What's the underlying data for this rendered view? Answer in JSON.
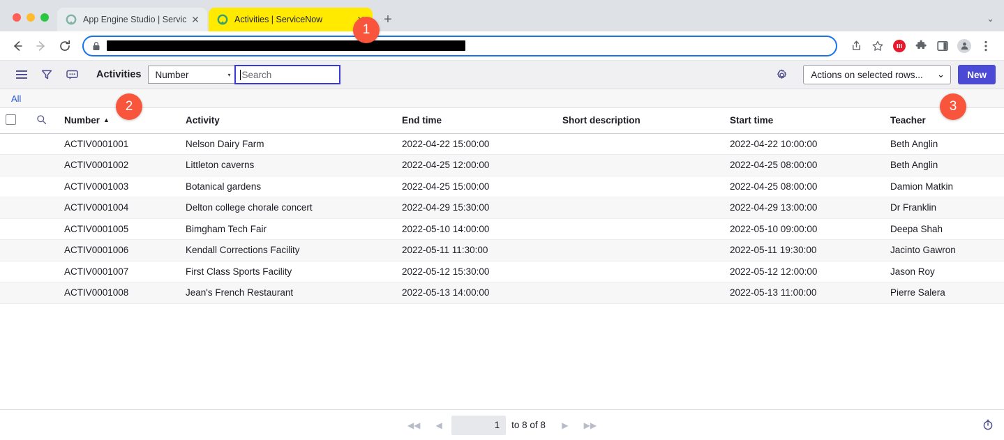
{
  "browser": {
    "tabs": [
      {
        "title": "App Engine Studio | ServiceNo",
        "favicon": "servicenow-logo-icon",
        "active": false
      },
      {
        "title": "Activities | ServiceNow",
        "favicon": "servicenow-logo-icon",
        "active": true
      }
    ],
    "new_tab_label": "+",
    "tab_list_chevron": "⌄",
    "close_label": "✕",
    "address_bar": {
      "value": "",
      "redacted": true,
      "lock": "site-secure-lock-icon"
    },
    "nav": {
      "back": "back-icon",
      "forward": "forward-icon",
      "reload": "reload-icon"
    },
    "toolbar_icons": [
      "share-icon",
      "bookmark-star-icon",
      "extension-red-icon",
      "extensions-puzzle-icon",
      "side-panel-icon",
      "profile-avatar-icon",
      "chrome-menu-icon"
    ]
  },
  "list_header": {
    "menu_icon": "hamburger-menu-icon",
    "filter_icon": "filter-funnel-icon",
    "comment_icon": "comment-bubble-icon",
    "title": "Activities",
    "field_select": {
      "value": "Number",
      "caret": "▾"
    },
    "search": {
      "value": "",
      "placeholder": "Search",
      "focused": true
    },
    "settings_icon": "gear-icon",
    "actions_select": {
      "value": "Actions on selected rows...",
      "caret": "⌄"
    },
    "new_button": "New"
  },
  "breadcrumb": {
    "label": "All"
  },
  "table": {
    "columns": [
      {
        "key": "check",
        "label": ""
      },
      {
        "key": "search",
        "label": ""
      },
      {
        "key": "number",
        "label": "Number",
        "sort": "▲"
      },
      {
        "key": "activity",
        "label": "Activity"
      },
      {
        "key": "end_time",
        "label": "End time"
      },
      {
        "key": "short_description",
        "label": "Short description"
      },
      {
        "key": "start_time",
        "label": "Start time"
      },
      {
        "key": "teacher",
        "label": "Teacher"
      }
    ],
    "rows": [
      {
        "number": "ACTIV0001001",
        "activity": "Nelson Dairy Farm",
        "end_time": "2022-04-22 15:00:00",
        "short_description": "",
        "start_time": "2022-04-22 10:00:00",
        "teacher": "Beth Anglin"
      },
      {
        "number": "ACTIV0001002",
        "activity": "Littleton caverns",
        "end_time": "2022-04-25 12:00:00",
        "short_description": "",
        "start_time": "2022-04-25 08:00:00",
        "teacher": "Beth Anglin"
      },
      {
        "number": "ACTIV0001003",
        "activity": "Botanical gardens",
        "end_time": "2022-04-25 15:00:00",
        "short_description": "",
        "start_time": "2022-04-25 08:00:00",
        "teacher": "Damion Matkin"
      },
      {
        "number": "ACTIV0001004",
        "activity": "Delton college chorale concert",
        "end_time": "2022-04-29 15:30:00",
        "short_description": "",
        "start_time": "2022-04-29 13:00:00",
        "teacher": "Dr Franklin"
      },
      {
        "number": "ACTIV0001005",
        "activity": "Bimgham Tech Fair",
        "end_time": "2022-05-10 14:00:00",
        "short_description": "",
        "start_time": "2022-05-10 09:00:00",
        "teacher": "Deepa Shah"
      },
      {
        "number": "ACTIV0001006",
        "activity": "Kendall Corrections Facility",
        "end_time": "2022-05-11 11:30:00",
        "short_description": "",
        "start_time": "2022-05-11 19:30:00",
        "teacher": "Jacinto Gawron"
      },
      {
        "number": "ACTIV0001007",
        "activity": "First Class Sports Facility",
        "end_time": "2022-05-12 15:30:00",
        "short_description": "",
        "start_time": "2022-05-12 12:00:00",
        "teacher": "Jason Roy"
      },
      {
        "number": "ACTIV0001008",
        "activity": "Jean's French Restaurant",
        "end_time": "2022-05-13 14:00:00",
        "short_description": "",
        "start_time": "2022-05-13 11:00:00",
        "teacher": "Pierre Salera"
      }
    ]
  },
  "footer": {
    "first_label": "◀◀",
    "prev_label": "◀",
    "page_value": "1",
    "range_label": "to 8 of 8",
    "next_label": "▶",
    "last_label": "▶▶",
    "timer_icon": "stopwatch-icon"
  },
  "annotations": [
    {
      "id": "1",
      "label": "1"
    },
    {
      "id": "2",
      "label": "2"
    },
    {
      "id": "3",
      "label": "3"
    }
  ],
  "colors": {
    "accent_blue": "#4a4ad6",
    "link_blue": "#2b58d9",
    "active_tab_highlight": "#ffea00",
    "annotation": "#f9553d",
    "omnibox_focus": "#1a73e8"
  }
}
